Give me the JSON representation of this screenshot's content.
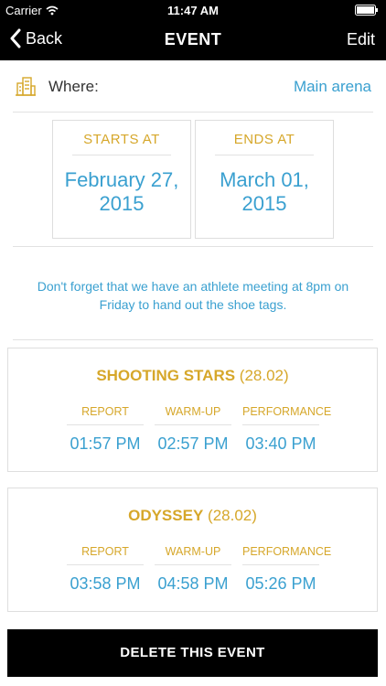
{
  "status_bar": {
    "carrier": "Carrier",
    "time": "11:47 AM"
  },
  "nav": {
    "back_label": "Back",
    "title": "EVENT",
    "edit_label": "Edit"
  },
  "where": {
    "label": "Where:",
    "value": "Main arena"
  },
  "dates": {
    "starts_label": "STARTS AT",
    "starts_line1": "February 27,",
    "starts_line2": "2015",
    "ends_label": "ENDS AT",
    "ends_line1": "March 01,",
    "ends_line2": "2015"
  },
  "note": "Don't forget that we have an athlete meeting at 8pm on Friday to hand out the shoe tags.",
  "groups": [
    {
      "name": "SHOOTING STARS",
      "date": "(28.02)",
      "columns": [
        {
          "label": "REPORT",
          "time": "01:57 PM"
        },
        {
          "label": "WARM-UP",
          "time": "02:57 PM"
        },
        {
          "label": "PERFORMANCE",
          "time": "03:40 PM"
        }
      ]
    },
    {
      "name": "ODYSSEY",
      "date": "(28.02)",
      "columns": [
        {
          "label": "REPORT",
          "time": "03:58 PM"
        },
        {
          "label": "WARM-UP",
          "time": "04:58 PM"
        },
        {
          "label": "PERFORMANCE",
          "time": "05:26 PM"
        }
      ]
    }
  ],
  "delete_label": "DELETE THIS EVENT",
  "colors": {
    "accent_blue": "#3aa0d0",
    "accent_gold": "#d6a72a",
    "bar_black": "#000000"
  },
  "icons": [
    "wifi-icon",
    "battery-icon",
    "back-chevron-icon",
    "building-icon"
  ]
}
